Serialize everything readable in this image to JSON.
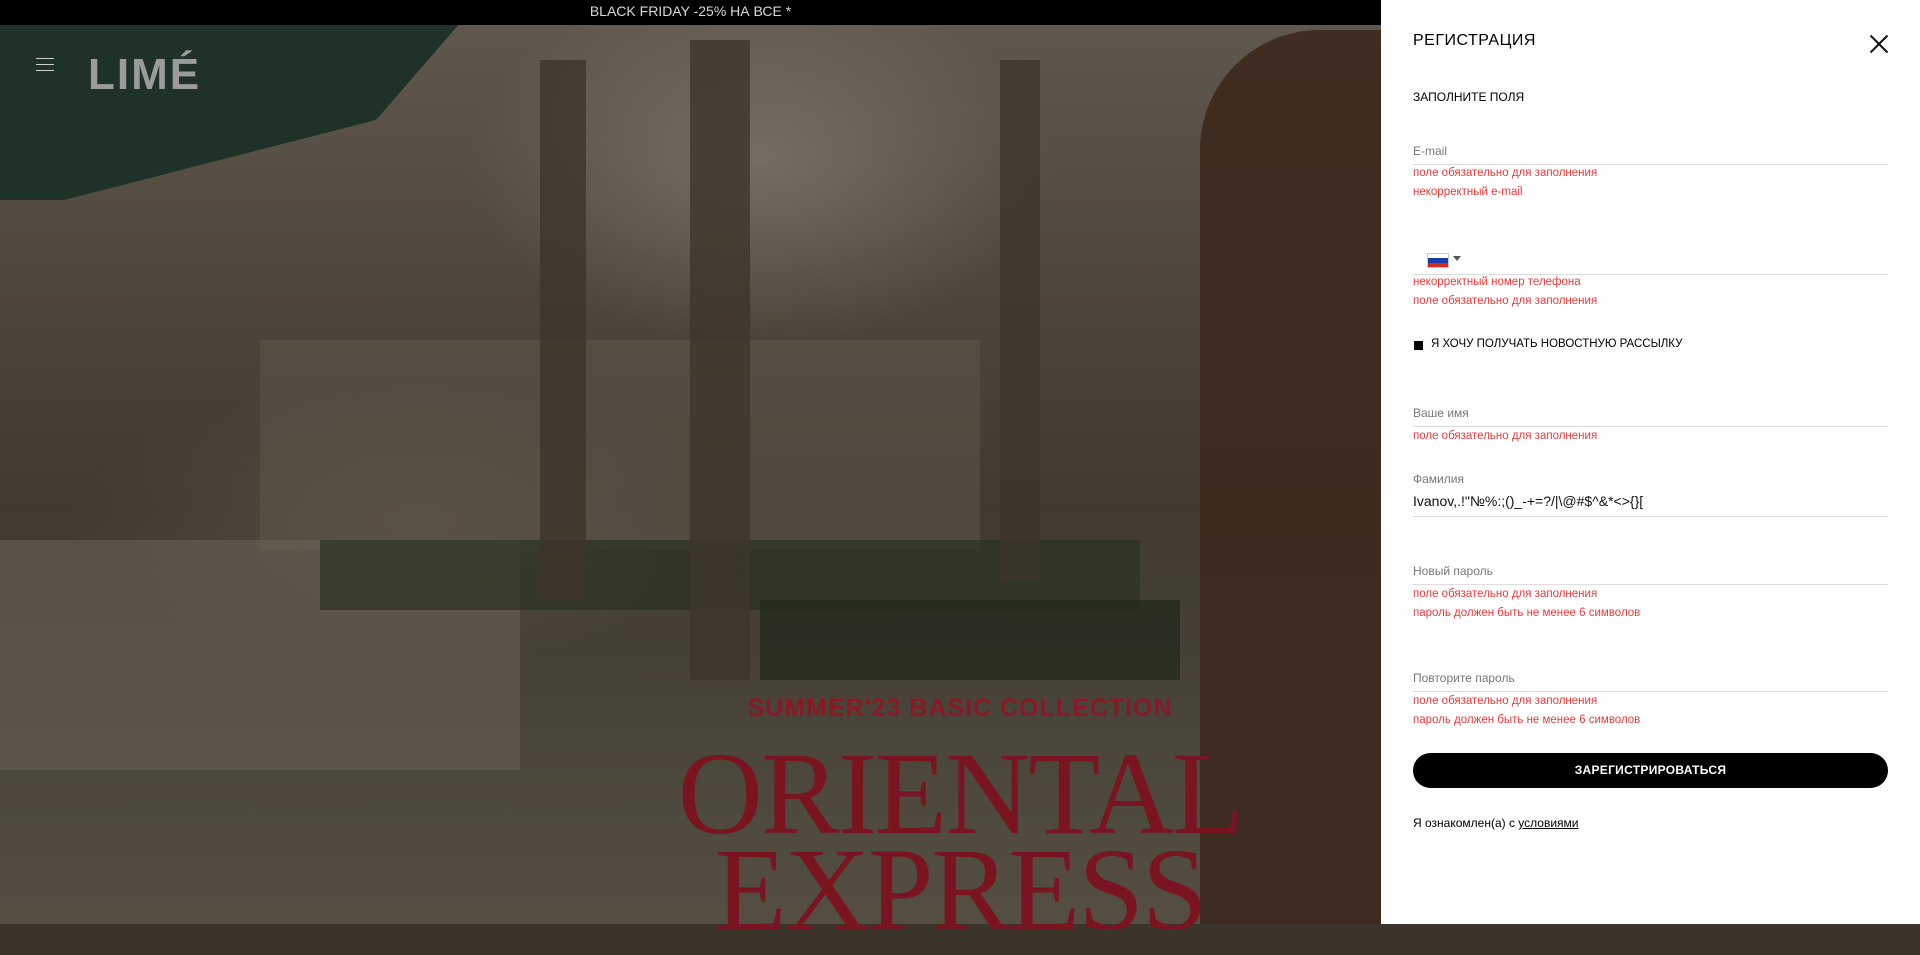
{
  "promo": {
    "text": "BLACK FRIDAY -25% НА ВСЕ *"
  },
  "header": {
    "logo": "LIMÉ"
  },
  "hero": {
    "subtitle": "SUMMER'23 BASIC COLLECTION",
    "title_line1": "ORIENTAL",
    "title_line2": "EXPRESS"
  },
  "form": {
    "title": "РЕГИСТРАЦИЯ",
    "subtitle": "ЗАПОЛНИТЕ ПОЛЯ",
    "email": {
      "label": "E-mail",
      "errors": [
        "поле обязательно для заполнения",
        "некорректный e-mail"
      ]
    },
    "phone": {
      "country_icon": "flag-russia-icon",
      "errors": [
        "некорректный номер телефона",
        "поле обязательно для заполнения"
      ]
    },
    "newsletter": {
      "label": "Я ХОЧУ ПОЛУЧАТЬ НОВОСТНУЮ РАССЫЛКУ",
      "checked": true
    },
    "first_name": {
      "label": "Ваше имя",
      "errors": [
        "поле обязательно для заполнения"
      ]
    },
    "last_name": {
      "label": "Фамилия",
      "value": "Ivanov,.!\"№%:;()_-+=?/|\\@#$^&*<>{}["
    },
    "new_password": {
      "label": "Новый пароль",
      "errors": [
        "поле обязательно для заполнения",
        "пароль должен быть не менее 6 символов"
      ]
    },
    "repeat_password": {
      "label": "Повторите пароль",
      "errors": [
        "поле обязательно для заполнения",
        "пароль должен быть не менее 6 символов"
      ]
    },
    "submit_label": "ЗАРЕГИСТРИРОВАТЬСЯ",
    "terms_prefix": "Я ознакомлен(а) с",
    "terms_link": "условиями"
  },
  "colors": {
    "error": "#e63a3a",
    "hero_red": "#8a1826",
    "button": "#000000"
  }
}
